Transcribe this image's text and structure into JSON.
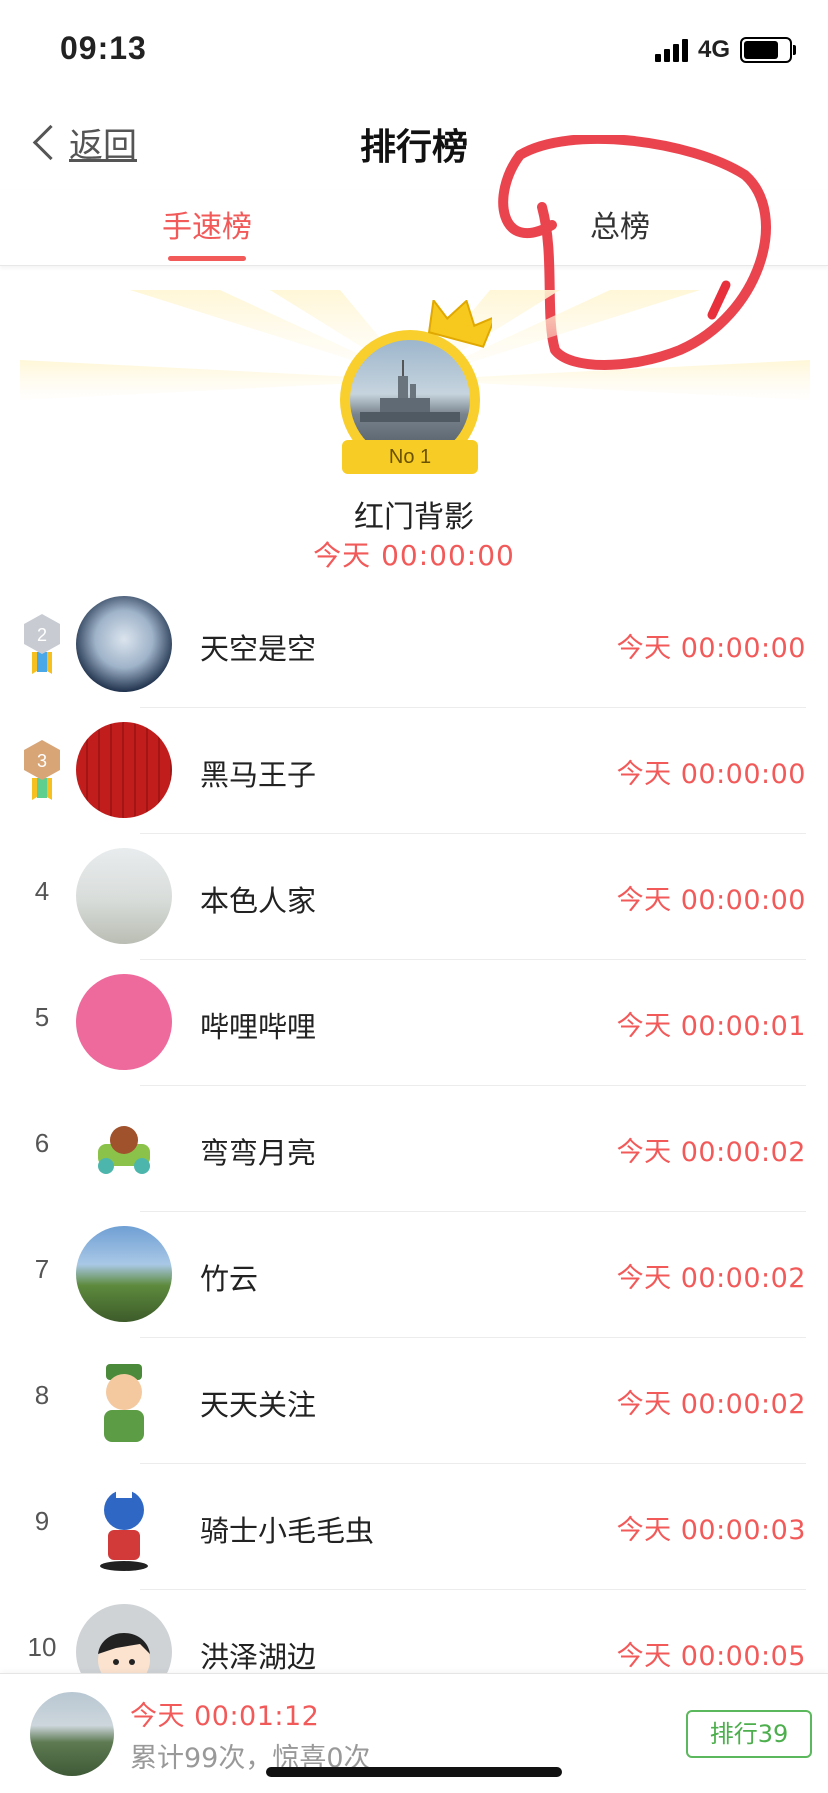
{
  "status": {
    "time": "09:13",
    "network": "4G",
    "battery_level": 0.85
  },
  "nav": {
    "back_label": "返回",
    "title": "排行榜"
  },
  "tabs": [
    {
      "label": "手速榜",
      "active": true
    },
    {
      "label": "总榜",
      "active": false
    }
  ],
  "champion": {
    "rank_badge": "No 1",
    "name": "红门背影",
    "time": "今天 00:00:00"
  },
  "rankings": [
    {
      "rank": "2",
      "name": "天空是空",
      "time": "今天 00:00:00"
    },
    {
      "rank": "3",
      "name": "黑马王子",
      "time": "今天 00:00:00"
    },
    {
      "rank": "4",
      "name": "本色人家",
      "time": "今天 00:00:00"
    },
    {
      "rank": "5",
      "name": "哔哩哔哩",
      "time": "今天 00:00:01"
    },
    {
      "rank": "6",
      "name": "弯弯月亮",
      "time": "今天 00:00:02"
    },
    {
      "rank": "7",
      "name": "竹云",
      "time": "今天 00:00:02"
    },
    {
      "rank": "8",
      "name": "天天关注",
      "time": "今天 00:00:02"
    },
    {
      "rank": "9",
      "name": "骑士小毛毛虫",
      "time": "今天 00:00:03"
    },
    {
      "rank": "10",
      "name": "洪泽湖边",
      "time": "今天 00:00:05"
    }
  ],
  "my_record": {
    "time": "今天 00:01:12",
    "stats": "累计99次，惊喜0次",
    "rank_button": "排行39"
  },
  "colors": {
    "accent": "#f25a5a",
    "gold": "#f7cd25",
    "green": "#4cae4c",
    "annotation": "#e8303c"
  }
}
